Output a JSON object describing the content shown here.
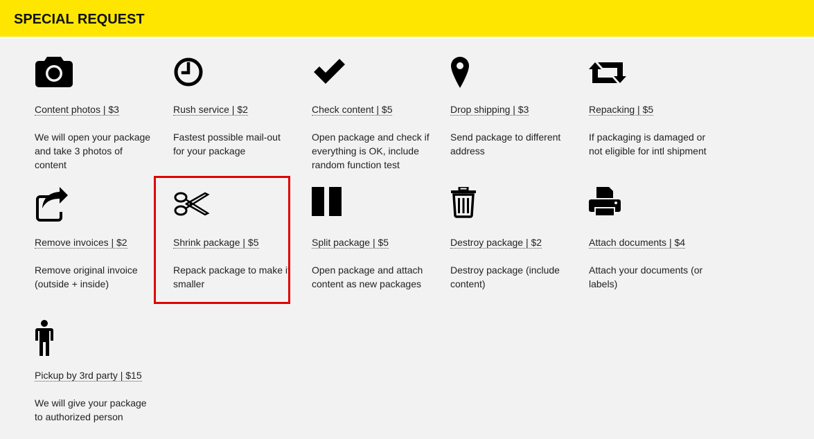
{
  "header": {
    "title": "SPECIAL REQUEST"
  },
  "services": [
    {
      "icon": "camera-icon",
      "title": "Content photos | $3",
      "desc": "We will open your package and take 3 photos of content"
    },
    {
      "icon": "clock-icon",
      "title": "Rush service | $2",
      "desc": "Fastest possible mail-out for your package"
    },
    {
      "icon": "checkmark-icon",
      "title": "Check content | $5",
      "desc": "Open package and check if everything is OK, include random function test"
    },
    {
      "icon": "map-pin-icon",
      "title": "Drop shipping | $3",
      "desc": "Send package to different address"
    },
    {
      "icon": "repeat-icon",
      "title": "Repacking | $5",
      "desc": "If packaging is damaged or not eligible for intl shipment"
    },
    {
      "icon": "share-icon",
      "title": "Remove invoices | $2",
      "desc": "Remove original invoice (outside + inside)"
    },
    {
      "icon": "scissors-icon",
      "title": "Shrink package | $5",
      "desc": "Repack package to make it smaller"
    },
    {
      "icon": "split-columns-icon",
      "title": "Split package | $5",
      "desc": "Open package and attach content as new packages"
    },
    {
      "icon": "trash-icon",
      "title": "Destroy package | $2",
      "desc": "Destroy package (include content)"
    },
    {
      "icon": "printer-icon",
      "title": "Attach documents | $4",
      "desc": "Attach your documents (or labels)"
    },
    {
      "icon": "person-icon",
      "title": "Pickup by 3rd party | $15",
      "desc": "We will give your package to authorized person"
    }
  ],
  "colors": {
    "header_bg": "#ffe600",
    "page_bg": "#f2f2f2",
    "highlight": "#e00000",
    "text": "#222222"
  }
}
